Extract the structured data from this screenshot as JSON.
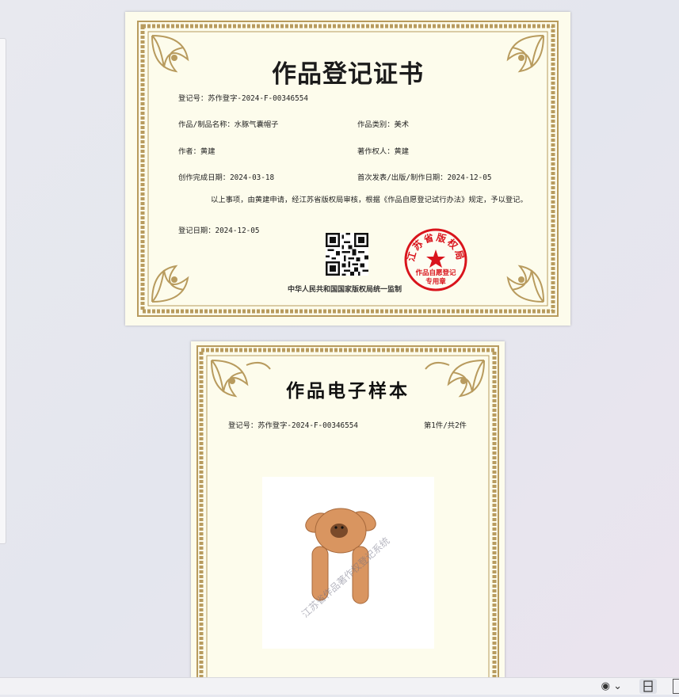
{
  "certificate": {
    "title": "作品登记证书",
    "reg_no": "登记号：苏作登字-2024-F-00346554",
    "work_name": "作品/制品名称：水豚气囊帽子",
    "work_type": "作品类别：美术",
    "author": "作者：黄建",
    "owner": "著作权人：黄建",
    "creation_date": "创作完成日期：2024-03-18",
    "publish_date": "首次发表/出版/制作日期：2024-12-05",
    "body": "以上事项，由黄建申请，经江苏省版权局审核，根据《作品自愿登记试行办法》规定，予以登记。",
    "reg_date": "登记日期：2024-12-05",
    "footer": "中华人民共和国国家版权局统一监制",
    "seal_top": "江苏省版权局",
    "seal_mid": "作品自愿登记",
    "seal_bottom": "专用章"
  },
  "sample": {
    "title": "作品电子样本",
    "reg_no": "登记号：苏作登字-2024-F-00346554",
    "page_info": "第1件/共2件",
    "watermark": "江苏省作品著作权登记系统"
  },
  "statusbar": {
    "view_icon": "eye-icon",
    "fit_icon": "fit-page-icon"
  },
  "colors": {
    "paper": "#fdfcec",
    "frame_gold": "#b89b5e",
    "seal_red": "#d9141c",
    "capybara": "#d99560"
  }
}
